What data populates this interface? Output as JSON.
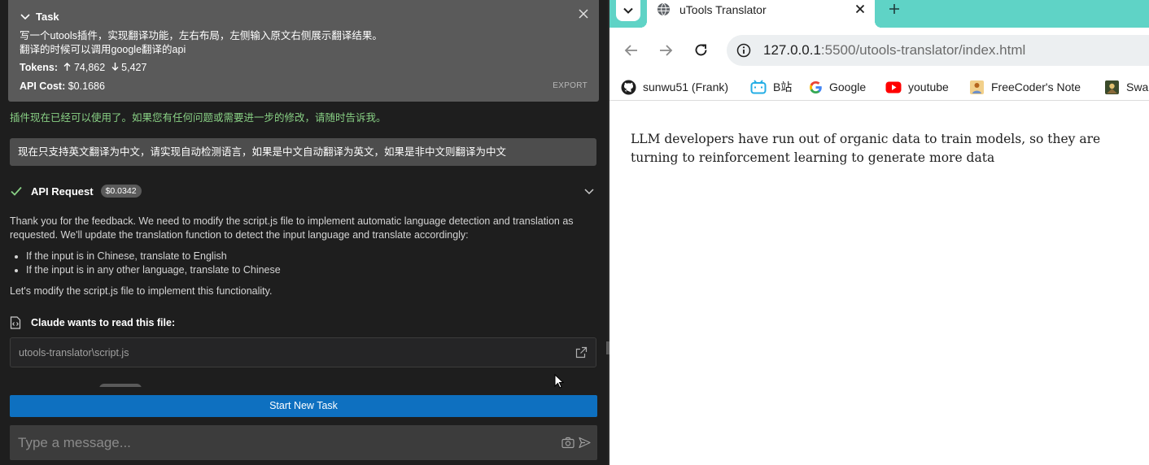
{
  "task": {
    "header": "Task",
    "line1": "写一个utools插件，实现翻译功能，左右布局，左侧输入原文右侧展示翻译结果。",
    "line2": "翻译的时候可以调用google翻译的api",
    "tokens_label": "Tokens:",
    "tokens_in": "74,862",
    "tokens_out": "5,427",
    "cost_label": "API Cost:",
    "cost_value": "$0.1686",
    "export_label": "EXPORT"
  },
  "chat": {
    "completion_text": "插件现在已经可以使用了。如果您有任何问题或需要进一步的修改，请随时告诉我。",
    "user_message": "现在只支持英文翻译为中文，请实现自动检测语言，如果是中文自动翻译为英文，如果是非中文则翻译为中文",
    "api_request_label": "API Request",
    "api_request_cost": "$0.0342",
    "response_intro": "Thank you for the feedback. We need to modify the script.js file to implement automatic language detection and translation as requested. We'll update the translation function to detect the input language and translate accordingly:",
    "response_bullets": [
      "If the input is in Chinese, translate to English",
      "If the input is in any other language, translate to Chinese"
    ],
    "response_outro": "Let's modify the script.js file to implement this functionality.",
    "read_file_label": "Claude wants to read this file:",
    "file_path": "utools-translator\\script.js"
  },
  "controls": {
    "start_new_task": "Start New Task",
    "message_placeholder": "Type a message..."
  },
  "browser": {
    "accent_color": "#5fd3c6",
    "tab_title": "uTools Translator",
    "url_host": "127.0.0.1",
    "url_rest": ":5500/utools-translator/index.html",
    "bookmarks": [
      {
        "label": "sunwu51 (Frank)",
        "icon": "github-icon"
      },
      {
        "label": "B站",
        "icon": "bilibili-icon"
      },
      {
        "label": "Google",
        "icon": "google-icon"
      },
      {
        "label": "youtube",
        "icon": "youtube-icon"
      },
      {
        "label": "FreeCoder's Note",
        "icon": "note-icon"
      },
      {
        "label": "Swa",
        "icon": "swa-icon"
      }
    ],
    "page_text": "LLM developers have run out of organic data to train models, so they are turning to reinforcement learning to generate more data"
  }
}
